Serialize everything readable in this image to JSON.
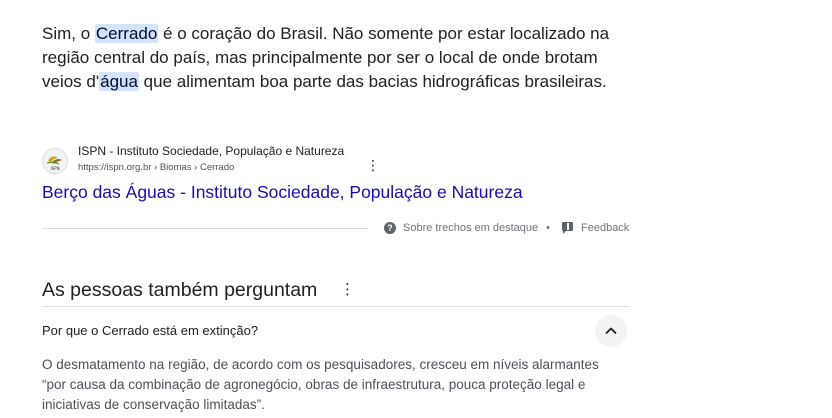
{
  "snippet": {
    "part1": "Sim, o ",
    "highlight1": "Cerrado",
    "part2": " é o coração do Brasil. Não somente por estar localizado na região central do país, mas principalmente por ser o local de onde brotam veios d'",
    "highlight2": "água",
    "part3": " que alimentam boa parte das bacias hidrográficas brasileiras."
  },
  "source": {
    "site_name": "ISPN - Instituto Sociedade, População e Natureza",
    "url": "https://ispn.org.br › Biomas › Cerrado",
    "favicon_icon": "ispn-logo-icon",
    "favicon_text": "ISPN",
    "menu_glyph": "⋮"
  },
  "result": {
    "title": "Berço das Águas - Instituto Sociedade, População e Natureza"
  },
  "meta": {
    "about_label": "Sobre trechos em destaque",
    "separator": "•",
    "feedback_label": "Feedback",
    "help_glyph": "?"
  },
  "paa": {
    "heading": "As pessoas também perguntam",
    "menu_glyph": "⋮",
    "question": "Por que o Cerrado está em extinção?",
    "answer": "O desmatamento na região, de acordo com os pesquisadores, cresceu em níveis alarmantes “por causa da combinação de agronegócio, obras de infraestrutura, pouca proteção legal e iniciativas de conservação limitadas”."
  },
  "colors": {
    "link": "#1a0dab",
    "highlight": "#d3e3fd",
    "secondary_text": "#70757a"
  }
}
